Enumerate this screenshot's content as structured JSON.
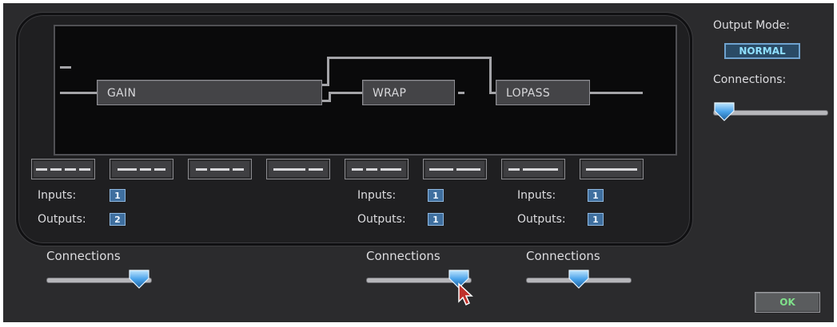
{
  "blocks": [
    {
      "label": "GAIN"
    },
    {
      "label": "WRAP"
    },
    {
      "label": "LOPASS"
    }
  ],
  "selectors": [
    {
      "pattern": "dash-4"
    },
    {
      "pattern": "dash-3a"
    },
    {
      "pattern": "dash-3b"
    },
    {
      "pattern": "dash-2a"
    },
    {
      "pattern": "dash-3c"
    },
    {
      "pattern": "dash-2b"
    },
    {
      "pattern": "dash-2c"
    },
    {
      "pattern": "solid"
    }
  ],
  "io": {
    "inputs_label": "Inputs:",
    "outputs_label": "Outputs:",
    "gain": {
      "inputs": "1",
      "outputs": "2"
    },
    "wrap": {
      "inputs": "1",
      "outputs": "1"
    },
    "lopass": {
      "inputs": "1",
      "outputs": "1"
    }
  },
  "connections": {
    "label": "Connections",
    "label_colon": "Connections:",
    "gain_level": 0.88,
    "wrap_level": 0.88,
    "lopass_level": 0.5,
    "output_level": 0.1
  },
  "output_mode": {
    "label": "Output Mode:",
    "value": "NORMAL"
  },
  "ok_label": "OK",
  "colors": {
    "background": "#2b2b2d",
    "display": "#0a0a0b",
    "badge_text": "#8fe0ff",
    "ok_text": "#7fe08a",
    "slider_thumb": "#4aa3ea"
  }
}
